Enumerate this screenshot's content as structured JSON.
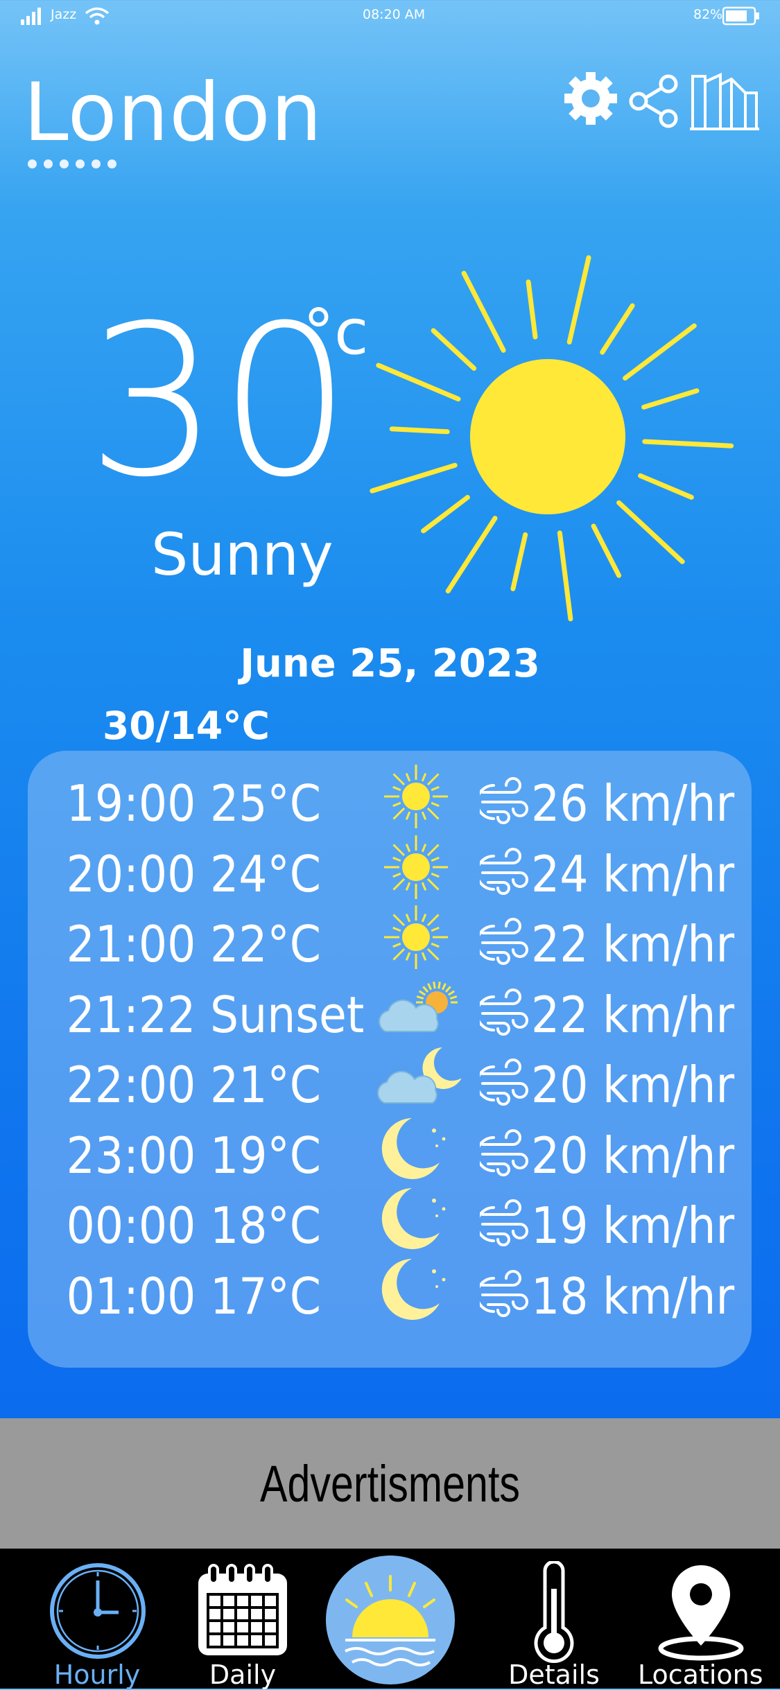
{
  "status_bar": {
    "carrier": "Jazz",
    "time": "08:20 AM",
    "battery": "82%"
  },
  "header": {
    "city": "London",
    "page_dots": 6,
    "icons": [
      "settings-icon",
      "share-icon",
      "city-icon"
    ]
  },
  "current": {
    "temperature": "30",
    "unit": "°c",
    "condition": "Sunny",
    "icon": "sun-icon",
    "date": "June 25, 2023",
    "range": "30/14°C"
  },
  "hourly": [
    {
      "time": "19:00",
      "temp": "25°C",
      "icon": "sun",
      "wind": "26 km/hr"
    },
    {
      "time": "20:00",
      "temp": "24°C",
      "icon": "sun",
      "wind": "24 km/hr"
    },
    {
      "time": "21:00",
      "temp": "22°C",
      "icon": "sun",
      "wind": "22 km/hr"
    },
    {
      "time": "21:22",
      "temp": "Sunset",
      "icon": "sunset",
      "wind": "22 km/hr"
    },
    {
      "time": "22:00",
      "temp": "21°C",
      "icon": "cloud-moon",
      "wind": "20 km/hr"
    },
    {
      "time": "23:00",
      "temp": "19°C",
      "icon": "moon",
      "wind": "20 km/hr"
    },
    {
      "time": "00:00",
      "temp": "18°C",
      "icon": "moon",
      "wind": "19 km/hr"
    },
    {
      "time": "01:00",
      "temp": "17°C",
      "icon": "moon",
      "wind": "18 km/hr"
    }
  ],
  "ads": {
    "label": "Advertisments"
  },
  "nav": {
    "items": [
      {
        "label": "Hourly",
        "icon": "clock-icon",
        "active": true
      },
      {
        "label": "Daily",
        "icon": "calendar-icon"
      },
      {
        "label": "",
        "icon": "sunrise-icon"
      },
      {
        "label": "Details",
        "icon": "thermometer-icon"
      },
      {
        "label": "Locations",
        "icon": "location-pin-icon"
      }
    ]
  },
  "colors": {
    "sun": "#ffe838",
    "active_nav": "#6ab0f5",
    "card": "#82b9f5"
  }
}
